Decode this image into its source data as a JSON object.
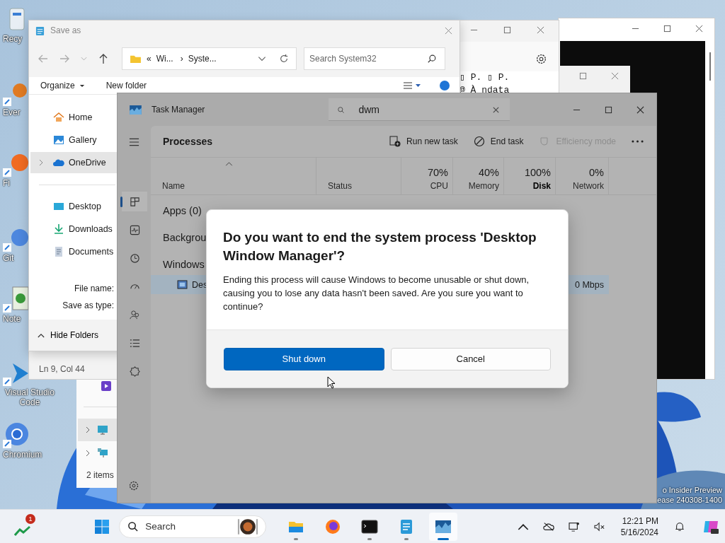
{
  "desktop": {
    "icons": [
      {
        "label": "Recy",
        "kind": "bin"
      },
      {
        "label": "Ever",
        "kind": "search"
      },
      {
        "label": "Fi",
        "kind": "browser"
      },
      {
        "label": "Git",
        "kind": "git"
      },
      {
        "label": "Note",
        "kind": "notes"
      },
      {
        "label": "Visual Studio Code",
        "kind": "code"
      },
      {
        "label": "Chromium",
        "kind": "globe"
      }
    ],
    "watermark": [
      "o Insider Preview",
      "ease 240308-1400"
    ]
  },
  "notepad_window": {
    "text_lines": [
      "▯ P. ▯ P.",
      "@ À ndata"
    ],
    "status": "Ln 9, Col 44"
  },
  "save_as": {
    "title": "Save as",
    "breadcrumb": [
      "«",
      "Wi...",
      "›",
      "Syste..."
    ],
    "search_placeholder": "Search System32",
    "toolbar": [
      "Organize",
      "New folder"
    ],
    "nav_groups": [
      [
        {
          "label": "Home",
          "kind": "home",
          "selected": false
        },
        {
          "label": "Gallery",
          "kind": "gallery",
          "selected": false
        },
        {
          "label": "OneDrive",
          "kind": "cloud",
          "selected": true
        }
      ],
      [
        {
          "label": "Desktop",
          "kind": "desktop",
          "selected": false
        },
        {
          "label": "Downloads",
          "kind": "download",
          "selected": false
        },
        {
          "label": "Documents",
          "kind": "documents",
          "selected": false
        }
      ]
    ],
    "fields": [
      "File name:",
      "Save as type:"
    ],
    "hide_folders": "Hide Folders"
  },
  "explorer_window": {
    "status": "2 items"
  },
  "task_manager": {
    "title": "Task Manager",
    "search_value": "dwm",
    "pages": [
      {
        "kind": "processes",
        "selected": true
      },
      {
        "kind": "performance",
        "selected": false
      },
      {
        "kind": "history",
        "selected": false
      },
      {
        "kind": "startup",
        "selected": false
      },
      {
        "kind": "users",
        "selected": false
      },
      {
        "kind": "details",
        "selected": false
      },
      {
        "kind": "services",
        "selected": false
      }
    ],
    "page_title": "Processes",
    "actions": [
      {
        "label": "Run new task",
        "kind": "run",
        "disabled": false
      },
      {
        "label": "End task",
        "kind": "end",
        "disabled": false
      },
      {
        "label": "Efficiency mode",
        "kind": "leaf",
        "disabled": true
      }
    ],
    "columns": [
      {
        "label": "Name",
        "sorted": true,
        "emphasis": false
      },
      {
        "label": "Status",
        "sorted": false,
        "emphasis": false
      },
      {
        "label": "CPU",
        "usage": "70%",
        "sorted": false,
        "emphasis": false
      },
      {
        "label": "Memory",
        "usage": "40%",
        "sorted": false,
        "emphasis": false
      },
      {
        "label": "Disk",
        "usage": "100%",
        "sorted": false,
        "emphasis": true
      },
      {
        "label": "Network",
        "usage": "0%",
        "sorted": false,
        "emphasis": false
      }
    ],
    "groups": [
      "Apps (0)",
      "Backgrou",
      "Windows"
    ],
    "row": {
      "name": "Des",
      "network": "0 Mbps",
      "selected": true
    }
  },
  "dialog": {
    "title": "Do you want to end the system process 'Desktop Window Manager'?",
    "message": "Ending this process will cause Windows to become unusable or shut down, causing you to lose any data hasn't been saved. Are you sure you want to continue?",
    "buttons": [
      {
        "label": "Shut down",
        "kind": "primary"
      },
      {
        "label": "Cancel",
        "kind": "secondary"
      }
    ]
  },
  "taskbar": {
    "widgets_badge": "1",
    "search_placeholder": "Search",
    "apps": [
      {
        "kind": "explorer",
        "running": true,
        "selected": false
      },
      {
        "kind": "firefox",
        "running": false,
        "selected": false
      },
      {
        "kind": "terminal",
        "running": true,
        "selected": false
      },
      {
        "kind": "notepad",
        "running": true,
        "selected": false
      },
      {
        "kind": "taskmgr",
        "running": true,
        "selected": true
      }
    ],
    "time": "12:21 PM",
    "date": "5/16/2024"
  }
}
